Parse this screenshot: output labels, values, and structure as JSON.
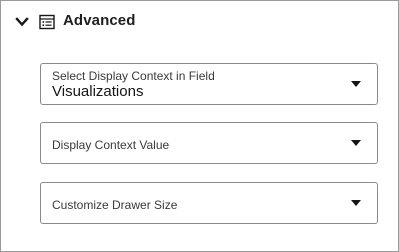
{
  "section": {
    "title": "Advanced",
    "expanded": true,
    "chevron_icon": "chevron-down-icon",
    "section_icon": "list-icon"
  },
  "fields": [
    {
      "label": "Select Display Context in Field",
      "value": "Visualizations"
    },
    {
      "label": "Display Context Value",
      "value": ""
    },
    {
      "label": "Customize Drawer Size",
      "value": ""
    }
  ],
  "colors": {
    "border": "#8a8a8a",
    "text": "#161616",
    "label": "#3a3a3a",
    "panel_border": "#9a9a9a"
  }
}
